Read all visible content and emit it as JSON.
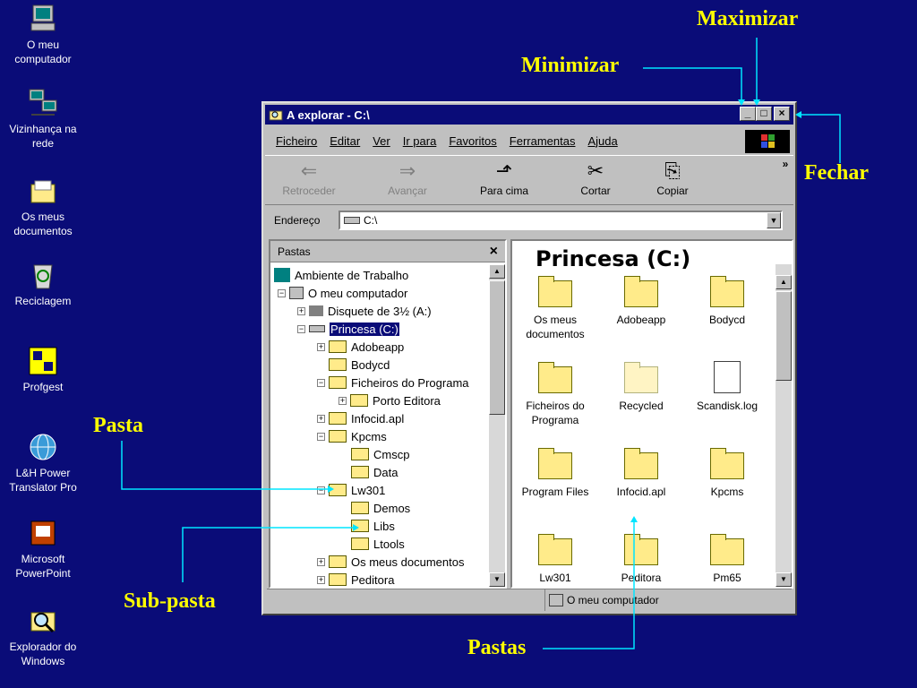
{
  "desktop": {
    "icons": [
      {
        "name": "o-meu-computador",
        "label": "O meu\ncomputador"
      },
      {
        "name": "vizinhanca-na-rede",
        "label": "Vizinhança na\nrede"
      },
      {
        "name": "os-meus-documentos",
        "label": "Os meus\ndocumentos"
      },
      {
        "name": "reciclagem",
        "label": "Reciclagem"
      },
      {
        "name": "profgest",
        "label": "Profgest"
      },
      {
        "name": "lh-power-translator",
        "label": "L&H Power\nTranslator Pro"
      },
      {
        "name": "microsoft-powerpoint",
        "label": "Microsoft\nPowerPoint"
      },
      {
        "name": "explorador-do-windows",
        "label": "Explorador do\nWindows"
      }
    ]
  },
  "annotations": {
    "maximizar": "Maximizar",
    "minimizar": "Minimizar",
    "fechar": "Fechar",
    "pasta": "Pasta",
    "sub_pasta": "Sub-pasta",
    "pastas": "Pastas"
  },
  "window": {
    "title": "A explorar - C:\\",
    "menu": [
      "Ficheiro",
      "Editar",
      "Ver",
      "Ir para",
      "Favoritos",
      "Ferramentas",
      "Ajuda"
    ],
    "toolbar": {
      "back": "Retroceder",
      "forward": "Avançar",
      "up": "Para cima",
      "cut": "Cortar",
      "copy": "Copiar",
      "more": "»"
    },
    "address": {
      "label": "Endereço",
      "value": "C:\\"
    },
    "left_panel": {
      "header": "Pastas",
      "close": "×",
      "tree": [
        "Ambiente de Trabalho",
        "O meu computador",
        "Disquete de 3½ (A:)",
        "Princesa (C:)",
        "Adobeapp",
        "Bodycd",
        "Ficheiros do Programa",
        "Porto Editora",
        "Infocid.apl",
        "Kpcms",
        "Cmscp",
        "Data",
        "Lw301",
        "Demos",
        "Libs",
        "Ltools",
        "Os meus documentos",
        "Peditora"
      ]
    },
    "right_panel": {
      "title": "Princesa (C:)",
      "items": [
        "Os meus documentos",
        "Adobeapp",
        "Bodycd",
        "Ficheiros do Programa",
        "Recycled",
        "Scandisk.log",
        "Program Files",
        "Infocid.apl",
        "Kpcms",
        "Lw301",
        "Peditora",
        "Pm65"
      ]
    },
    "status": "O meu computador"
  },
  "colors": {
    "desktop": "#0a0c78",
    "annotation": "#ffff00",
    "line": "#00e5ff",
    "folder": "#ffeb8a"
  }
}
